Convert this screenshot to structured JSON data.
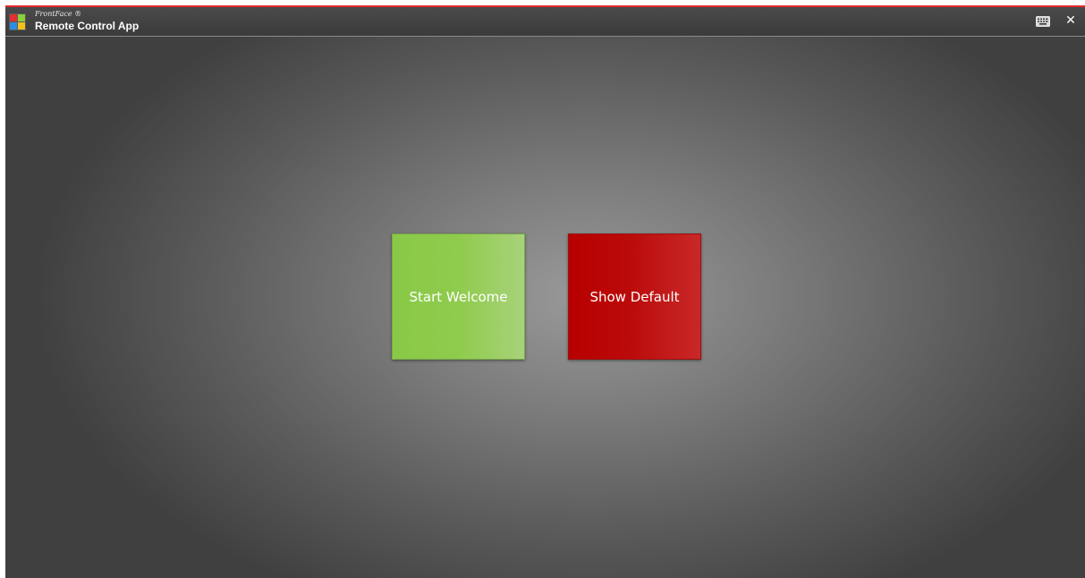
{
  "titlebar": {
    "brand": "FrontFace ®",
    "title": "Remote Control App",
    "keyboard_icon": "keyboard-icon",
    "close_icon": "close-icon",
    "close_glyph": "✕"
  },
  "tiles": [
    {
      "label": "Start Welcome",
      "color": "#8ac947"
    },
    {
      "label": "Show Default",
      "color": "#b80000"
    }
  ],
  "colors": {
    "accent_line": "#e02a2a",
    "titlebar_bg": "#3b3b3b"
  }
}
